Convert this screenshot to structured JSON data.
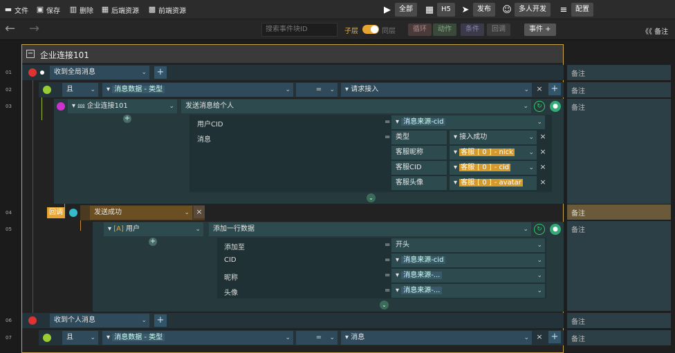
{
  "toolbar": {
    "file": "文件",
    "save": "保存",
    "delete": "删除",
    "backend": "后端资源",
    "frontend": "前端资源",
    "run_all": "全部",
    "h5": "H5",
    "publish": "发布",
    "multi_dev": "多人开发",
    "config": "配置"
  },
  "navbar": {
    "search_placeholder": "搜索事件块ID",
    "sublayer": "子层",
    "same_layer": "同层",
    "loop": "循环",
    "action": "动作",
    "condition": "条件",
    "callback": "回调",
    "event": "事件 +",
    "notes": "《《 备注"
  },
  "lines": [
    "01",
    "02",
    "03",
    "04",
    "05",
    "06",
    "07"
  ],
  "frame": {
    "title": "企业连接101"
  },
  "rows": {
    "r1": {
      "event": "收到全局消息",
      "note": "备注"
    },
    "r2": {
      "logic": "且",
      "field": "消息数据 - 类型",
      "op": "=",
      "value": "请求接入",
      "note": "备注"
    },
    "r3": {
      "target": "企业连接101",
      "action": "发送消息给个人",
      "note": "备注"
    },
    "p1": {
      "label": "用户CID",
      "eq": "=",
      "value": "消息来源-cid"
    },
    "p2": {
      "label": "消息",
      "eq": "=",
      "key": "类型",
      "value": "接入成功"
    },
    "p3": {
      "key": "客服昵称",
      "v1": "客服",
      "v2": "[ 0 ]",
      "v3": "- nick"
    },
    "p4": {
      "key": "客服CID",
      "v1": "客服",
      "v2": "[ 0 ]",
      "v3": "- cid"
    },
    "p5": {
      "key": "客服头像",
      "v1": "客服",
      "v2": "[ 0 ]",
      "v3": "- avatar"
    },
    "r4": {
      "callback": "回调",
      "event": "发送成功",
      "note": "备注"
    },
    "r5": {
      "target_icon": "[A]",
      "target": "用户",
      "action": "添加一行数据",
      "note": "备注"
    },
    "q1": {
      "label": "添加至",
      "eq": "=",
      "value": "开头"
    },
    "q2": {
      "label": "CID",
      "eq": "=",
      "value": "消息来源-cid"
    },
    "q3": {
      "label": "昵称",
      "eq": "=",
      "value": "消息来源-..."
    },
    "q4": {
      "label": "头像",
      "eq": "=",
      "value": "消息来源-..."
    },
    "r6": {
      "event": "收到个人消息",
      "note": "备注"
    },
    "r7": {
      "logic": "且",
      "field": "消息数据 - 类型",
      "op": "=",
      "value": "消息",
      "note": "备注"
    }
  }
}
